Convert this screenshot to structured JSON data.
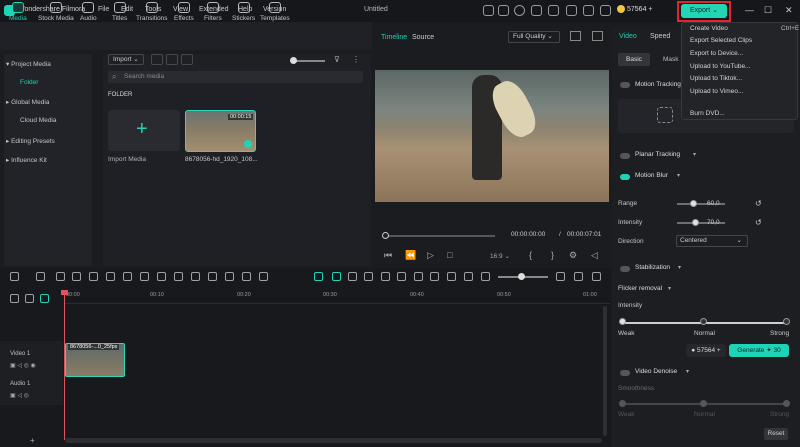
{
  "app": {
    "name": "Wondershare Filmora",
    "doc_title": "Untitled",
    "credits": "57564"
  },
  "menu": [
    "File",
    "Edit",
    "Tools",
    "View",
    "Extended",
    "Help",
    "Version"
  ],
  "export_label": "Export",
  "export_menu": [
    "Create Video",
    "Export Selected Clips",
    "Export to Device...",
    "Upload to YouTube...",
    "Upload to Tiktok...",
    "Upload to Vimeo...",
    "Burn DVD..."
  ],
  "export_shortcut": "Ctrl+E",
  "tools": [
    "Media",
    "Stock Media",
    "Audio",
    "Titles",
    "Transitions",
    "Effects",
    "Filters",
    "Stickers",
    "Templates"
  ],
  "sidebar": [
    "Project Media",
    "Folder",
    "Global Media",
    "Cloud Media",
    "Editing Presets",
    "Influence Kit"
  ],
  "media": {
    "import_btn": "Import",
    "search_placeholder": "Search media",
    "folder_label": "FOLDER",
    "import_tile": "Import Media",
    "clip_name": "8678056-hd_1920_108...",
    "clip_duration": "00:00:15"
  },
  "player": {
    "tab_timeline": "Timeline",
    "tab_source": "Source",
    "quality": "Full Quality",
    "time_current": "00:00:00:00",
    "time_sep": "/",
    "time_total": "00:00:07:01",
    "ratio": "16:9"
  },
  "right_panel": {
    "tabs": [
      "Video",
      "Speed"
    ],
    "subtabs": [
      "Basic",
      "Mask"
    ],
    "motion_tracking": "Motion Tracking",
    "planar_tracking": "Planar Tracking",
    "motion_blur": "Motion Blur",
    "range_label": "Range",
    "range_value": "60,0",
    "intensity_label": "Intensity",
    "intensity_value": "70,0",
    "direction_label": "Direction",
    "direction_value": "Centered",
    "stabilization": "Stabilization",
    "flicker_removal": "Flicker removal",
    "flicker_intensity": "Intensity",
    "levels": [
      "Weak",
      "Normal",
      "Strong"
    ],
    "gen_credits": "57564",
    "generate_label": "Generate",
    "generate_cost": "30",
    "video_denoise": "Video Denoise",
    "smoothness": "Smoothness",
    "reset": "Reset"
  },
  "timeline": {
    "ticks": [
      "00:00",
      "00:10",
      "00:20",
      "00:30",
      "00:40",
      "00:50",
      "01:00"
    ],
    "video_track": "Video 1",
    "audio_track": "Audio 1",
    "clip_label": "8678056-...0_25fps"
  },
  "colors": {
    "accent": "#1fd3b6",
    "highlight": "#e3242b",
    "playhead": "#e0555b"
  }
}
